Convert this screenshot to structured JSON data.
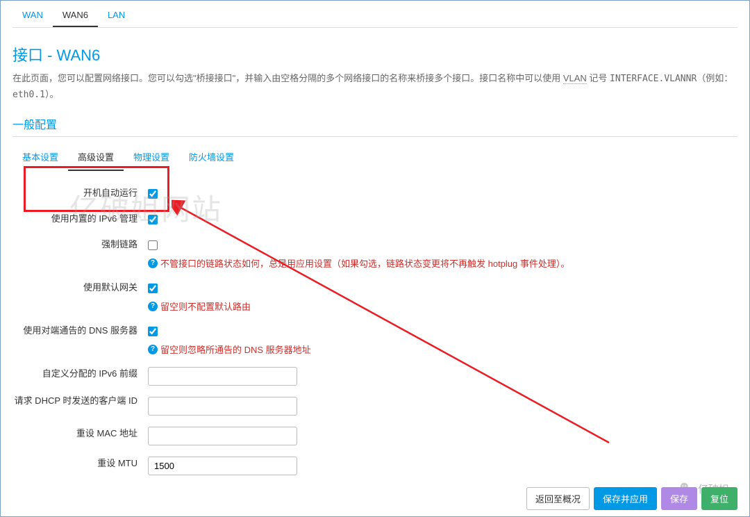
{
  "top_tabs": {
    "wan": "WAN",
    "wan6": "WAN6",
    "lan": "LAN"
  },
  "title": "接口 - WAN6",
  "desc_parts": {
    "p1": "在此页面，您可以配置网络接口。您可以勾选\"桥接接口\"，并输入由空格分隔的多个网络接口的名称来桥接多个接口。接口名称中可以使用 ",
    "vlan": "VLAN",
    "p2": " 记号 ",
    "iface": "INTERFACE.VLANNR",
    "p3": "（例如：",
    "eth": "eth0.1",
    "p4": "）。"
  },
  "section_title": "一般配置",
  "sub_tabs": {
    "basic": "基本设置",
    "advanced": "高级设置",
    "physical": "物理设置",
    "firewall": "防火墙设置"
  },
  "labels": {
    "auto_start": "开机自动运行",
    "builtin_ipv6": "使用内置的 IPv6 管理",
    "force_link": "强制链路",
    "default_gw": "使用默认网关",
    "peer_dns": "使用对端通告的 DNS 服务器",
    "ipv6_prefix": "自定义分配的 IPv6 前缀",
    "client_id": "请求 DHCP 时发送的客户端 ID",
    "reset_mac": "重设 MAC 地址",
    "reset_mtu": "重设 MTU"
  },
  "help": {
    "force_link": "不管接口的链路状态如何，总是用应用设置（如果勾选，链路状态变更将不再触发 hotplug 事件处理）。",
    "default_gw": "留空则不配置默认路由",
    "peer_dns": "留空则忽略所通告的 DNS 服务器地址"
  },
  "values": {
    "mtu": "1500",
    "ipv6_prefix": "",
    "client_id": "",
    "mac": ""
  },
  "buttons": {
    "back": "返回至概况",
    "save_apply": "保存并应用",
    "save": "保存",
    "reset": "复位"
  },
  "watermark": "亿破姐网站",
  "wechat": "亿破姐",
  "help_icon": "?"
}
